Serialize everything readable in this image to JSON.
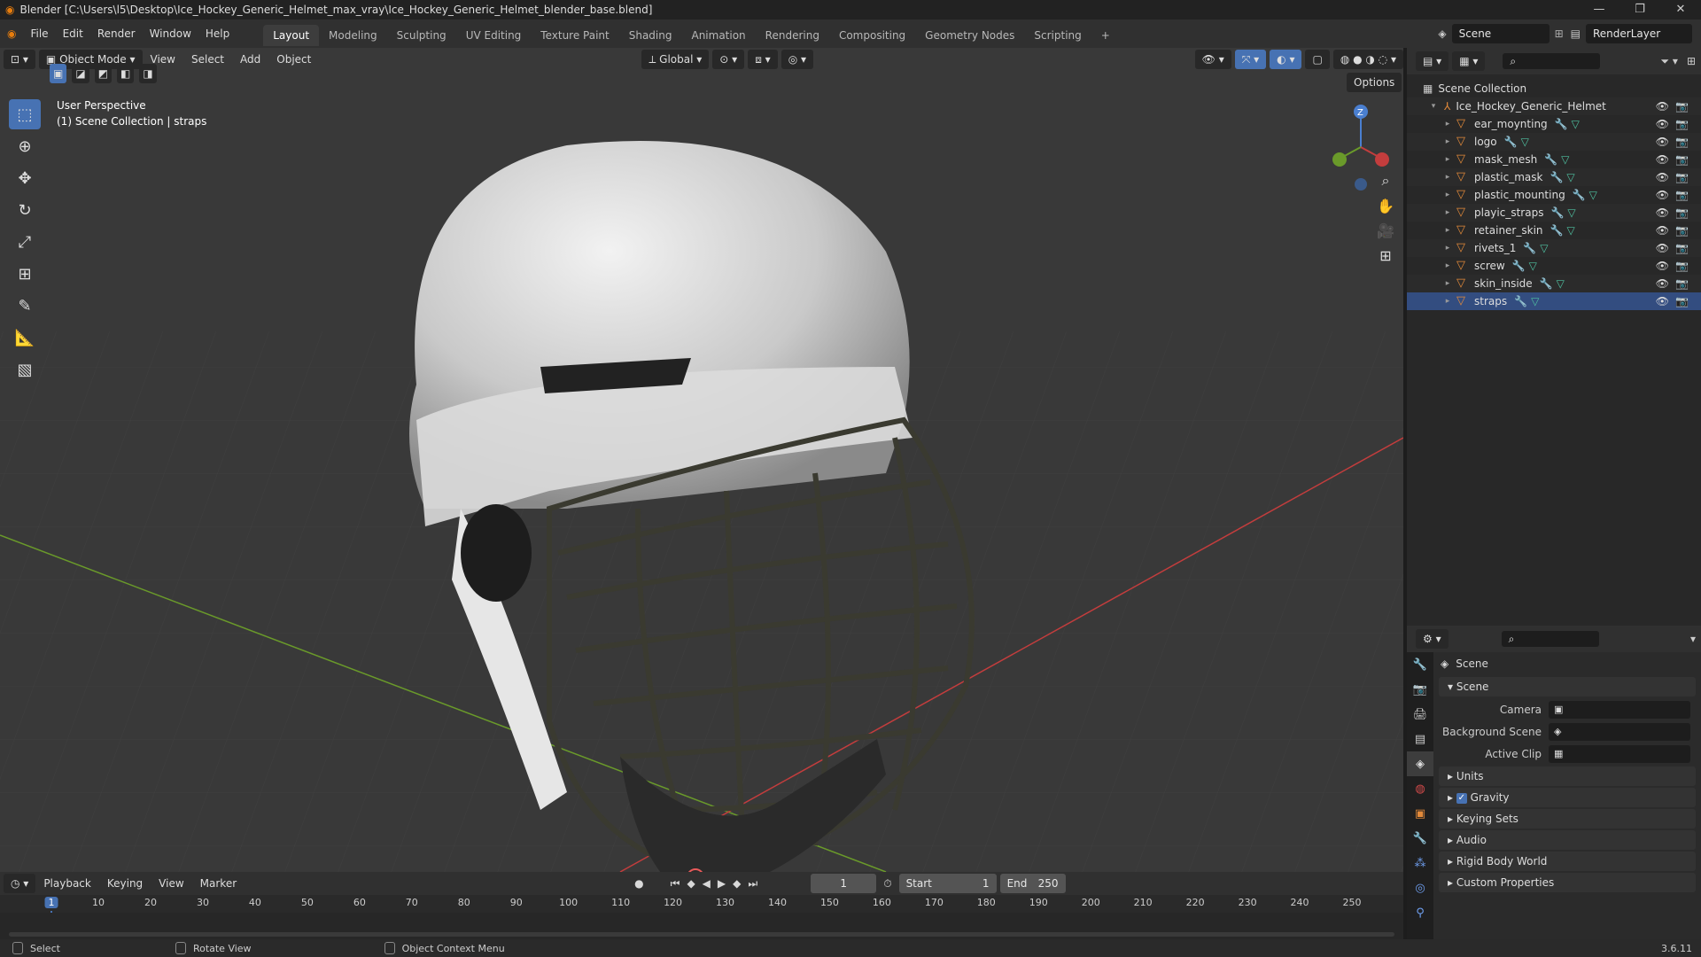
{
  "window": {
    "title": "Blender [C:\\Users\\l5\\Desktop\\Ice_Hockey_Generic_Helmet_max_vray\\Ice_Hockey_Generic_Helmet_blender_base.blend]",
    "controls": [
      "—",
      "❐",
      "✕"
    ]
  },
  "menus": [
    "File",
    "Edit",
    "Render",
    "Window",
    "Help"
  ],
  "workspaces": [
    "Layout",
    "Modeling",
    "Sculpting",
    "UV Editing",
    "Texture Paint",
    "Shading",
    "Animation",
    "Rendering",
    "Compositing",
    "Geometry Nodes",
    "Scripting",
    "+"
  ],
  "active_workspace": "Layout",
  "scene_field": "Scene",
  "renderlayer_field": "RenderLayer",
  "viewport_header": {
    "mode": "Object Mode",
    "menus": [
      "View",
      "Select",
      "Add",
      "Object"
    ],
    "orientation": "Global",
    "options": "Options"
  },
  "viewport": {
    "perspective": "User Perspective",
    "collection_info": "(1) Scene Collection | straps",
    "gizmo_z": "Z"
  },
  "tools": [
    "select-box",
    "cursor",
    "move",
    "rotate",
    "scale",
    "transform",
    "annotate",
    "measure",
    "add-cube"
  ],
  "outliner": {
    "root": "Scene Collection",
    "collection": "Ice_Hockey_Generic_Helmet",
    "objects": [
      "ear_moynting",
      "logo",
      "mask_mesh",
      "plastic_mask",
      "plastic_mounting",
      "playic_straps",
      "retainer_skin",
      "rivets_1",
      "screw",
      "skin_inside",
      "straps"
    ],
    "selected": "straps"
  },
  "properties": {
    "title": "Scene",
    "section": "Scene",
    "camera_label": "Camera",
    "background_label": "Background Scene",
    "clip_label": "Active Clip",
    "panels": [
      "Units",
      "Gravity",
      "Keying Sets",
      "Audio",
      "Rigid Body World",
      "Custom Properties"
    ],
    "gravity_checked": true
  },
  "timeline": {
    "menus": [
      "Playback",
      "Keying",
      "View",
      "Marker"
    ],
    "current_frame": "1",
    "start_label": "Start",
    "start": "1",
    "end_label": "End",
    "end": "250",
    "ticks": [
      "1",
      "10",
      "20",
      "30",
      "40",
      "50",
      "60",
      "70",
      "80",
      "90",
      "100",
      "110",
      "120",
      "130",
      "140",
      "150",
      "160",
      "170",
      "180",
      "190",
      "200",
      "210",
      "220",
      "230",
      "240",
      "250"
    ]
  },
  "statusbar": {
    "select": "Select",
    "rotate": "Rotate View",
    "context": "Object Context Menu",
    "version": "3.6.11"
  },
  "colors": {
    "accent": "#4772b3",
    "x_axis": "#c33d3d",
    "y_axis": "#6a9a2a",
    "frame_marker": "#4772b3"
  }
}
